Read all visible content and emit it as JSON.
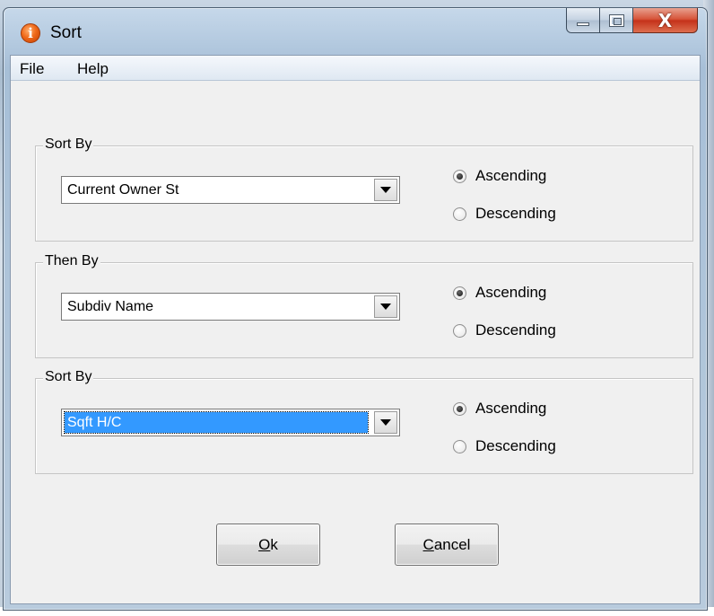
{
  "window": {
    "title": "Sort",
    "icon": "info-icon",
    "icon_glyph": "i",
    "controls": {
      "minimize": "minimize-icon",
      "maximize": "maximize-icon",
      "close_glyph": "X"
    }
  },
  "menu": {
    "items": [
      "File",
      "Help"
    ]
  },
  "groups": [
    {
      "legend": "Sort By",
      "selected_field": "Current Owner St",
      "highlighted": false,
      "order": {
        "ascending": "Ascending",
        "descending": "Descending",
        "selected": "Ascending"
      }
    },
    {
      "legend": "Then By",
      "selected_field": "Subdiv Name",
      "highlighted": false,
      "order": {
        "ascending": "Ascending",
        "descending": "Descending",
        "selected": "Ascending"
      }
    },
    {
      "legend": "Sort By",
      "selected_field": "Sqft H/C",
      "highlighted": true,
      "order": {
        "ascending": "Ascending",
        "descending": "Descending",
        "selected": "Ascending"
      }
    }
  ],
  "buttons": {
    "ok": {
      "mnemonic": "O",
      "rest": "k"
    },
    "cancel": {
      "mnemonic": "C",
      "rest": "ancel"
    }
  },
  "colors": {
    "selection": "#3399ff",
    "close_button": "#c5321a"
  }
}
